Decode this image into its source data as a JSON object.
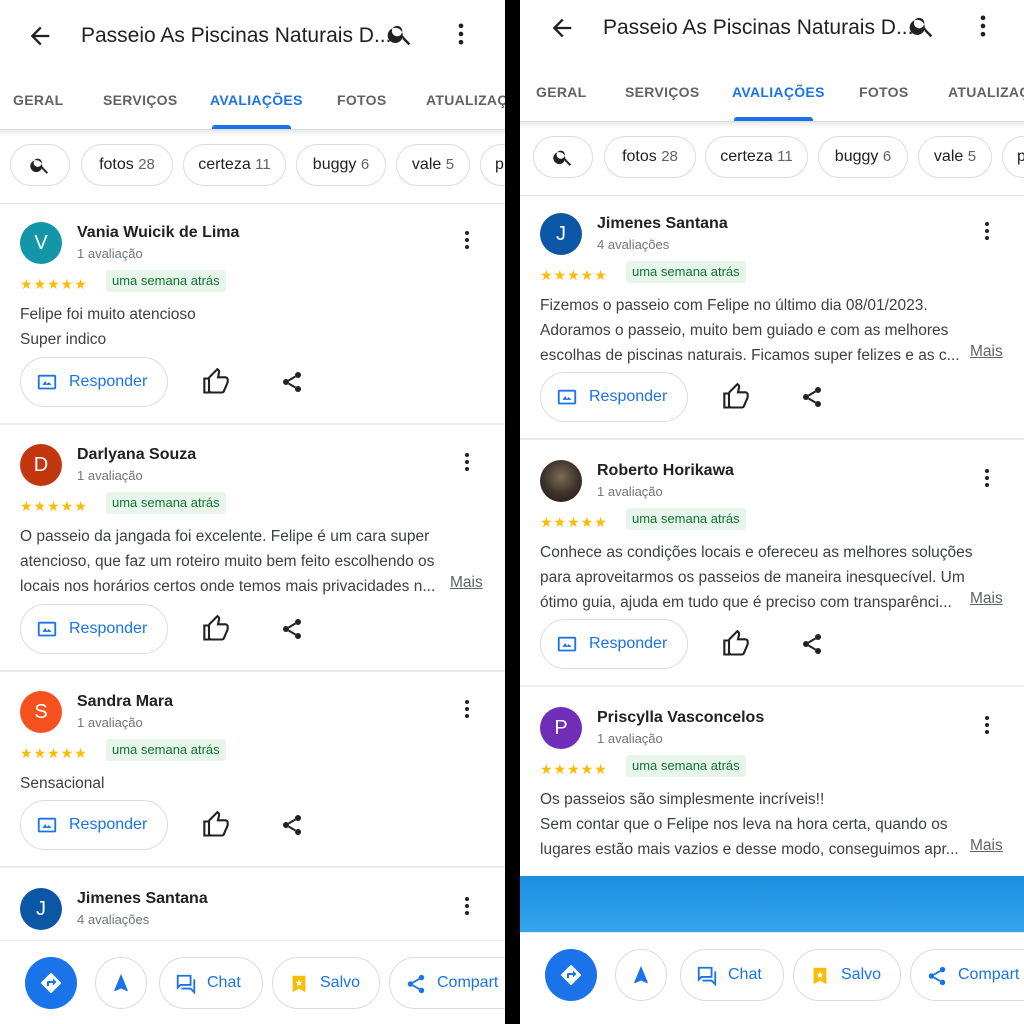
{
  "panels": {
    "left": {
      "header": {
        "title": "Passeio As Piscinas Naturais D..."
      },
      "tabs": [
        "GERAL",
        "SERVIÇOS",
        "AVALIAÇÕES",
        "FOTOS",
        "ATUALIZAÇÕ"
      ],
      "chips": [
        {
          "label": "fotos",
          "count": "28"
        },
        {
          "label": "certeza",
          "count": "11"
        },
        {
          "label": "buggy",
          "count": "6"
        },
        {
          "label": "vale",
          "count": "5"
        },
        {
          "label": "p",
          "count": ""
        }
      ],
      "reviews": [
        {
          "initial": "V",
          "name": "Vania Wuicik de Lima",
          "count": "1 avaliação",
          "stars": "★★★★★",
          "time": "uma semana atrás",
          "text": "Felipe foi muito atencioso\nSuper indico",
          "more": "",
          "reply": "Responder"
        },
        {
          "initial": "D",
          "name": "Darlyana Souza",
          "count": "1 avaliação",
          "stars": "★★★★★",
          "time": "uma semana atrás",
          "text": "O passeio da jangada foi excelente. Felipe é um cara super\natencioso, que faz um roteiro muito bem feito escolhendo os\nlocais nos horários certos onde temos mais privacidades n...",
          "more": "Mais",
          "reply": "Responder"
        },
        {
          "initial": "S",
          "name": "Sandra Mara",
          "count": "1 avaliação",
          "stars": "★★★★★",
          "time": "uma semana atrás",
          "text": "Sensacional",
          "more": "",
          "reply": "Responder"
        },
        {
          "initial": "J",
          "name": "Jimenes Santana",
          "count": "4 avaliações"
        }
      ],
      "bottom": {
        "chat": "Chat",
        "saved": "Salvo",
        "share": "Compart"
      }
    },
    "right": {
      "header": {
        "title": "Passeio As Piscinas Naturais D..."
      },
      "tabs": [
        "GERAL",
        "SERVIÇOS",
        "AVALIAÇÕES",
        "FOTOS",
        "ATUALIZAÇÕ"
      ],
      "chips": [
        {
          "label": "fotos",
          "count": "28"
        },
        {
          "label": "certeza",
          "count": "11"
        },
        {
          "label": "buggy",
          "count": "6"
        },
        {
          "label": "vale",
          "count": "5"
        },
        {
          "label": "p",
          "count": ""
        }
      ],
      "reviews": [
        {
          "initial": "J",
          "name": "Jimenes Santana",
          "count": "4 avaliações",
          "stars": "★★★★★",
          "time": "uma semana atrás",
          "text": "Fizemos o passeio com Felipe no último dia 08/01/2023.\nAdoramos o passeio, muito bem guiado e com as melhores\nescolhas de piscinas naturais. Ficamos super felizes e as c...",
          "more": "Mais",
          "reply": "Responder"
        },
        {
          "initial": "",
          "name": "Roberto Horikawa",
          "count": "1 avaliação",
          "stars": "★★★★★",
          "time": "uma semana atrás",
          "text": "Conhece as condições locais e ofereceu as melhores soluções\npara aproveitarmos os passeios de maneira inesquecível. Um\nótimo guia, ajuda em tudo que é preciso com transparênci...",
          "more": "Mais",
          "reply": "Responder"
        },
        {
          "initial": "P",
          "name": "Priscylla Vasconcelos",
          "count": "1 avaliação",
          "stars": "★★★★★",
          "time": "uma semana atrás",
          "text": "Os passeios são simplesmente incríveis!!\nSem contar que o Felipe nos leva na hora certa, quando os\nlugares estão mais vazios e desse modo, conseguimos apr...",
          "more": "Mais",
          "reply": "Responder"
        }
      ],
      "bottom": {
        "chat": "Chat",
        "saved": "Salvo",
        "share": "Compart"
      }
    }
  },
  "colors": {
    "accent": "#1a73e8",
    "star": "#fbbc04",
    "time_bg": "#e6f4ea",
    "time_text": "#137333",
    "avatar_v": "#1296a8",
    "avatar_d": "#c3370f",
    "avatar_s": "#f4511e",
    "avatar_j": "#0b57a6",
    "avatar_p": "#6f2db8"
  }
}
